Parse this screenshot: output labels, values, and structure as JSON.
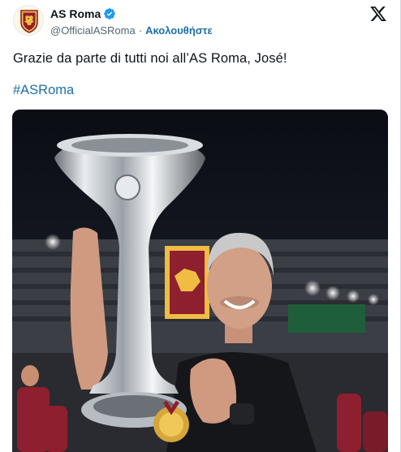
{
  "account": {
    "display_name": "AS Roma",
    "handle": "@OfficialASRoma",
    "separator": "·",
    "follow_label": "Ακολουθήστε",
    "verified_icon": "verified-badge-icon",
    "avatar_icon": "as-roma-crest-icon"
  },
  "platform": {
    "logo_icon": "x-logo-icon"
  },
  "tweet": {
    "text": "Grazie da parte di tutti noi all’AS Roma, José!",
    "hashtag": "#ASRoma"
  },
  "media": {
    "type": "photo"
  },
  "colors": {
    "link": "#1d6fa5",
    "verified": "#1d9bf0",
    "handle": "#536471",
    "text": "#0f1419",
    "roma_maroon": "#8e1f2f",
    "roma_gold": "#f0bc42"
  }
}
